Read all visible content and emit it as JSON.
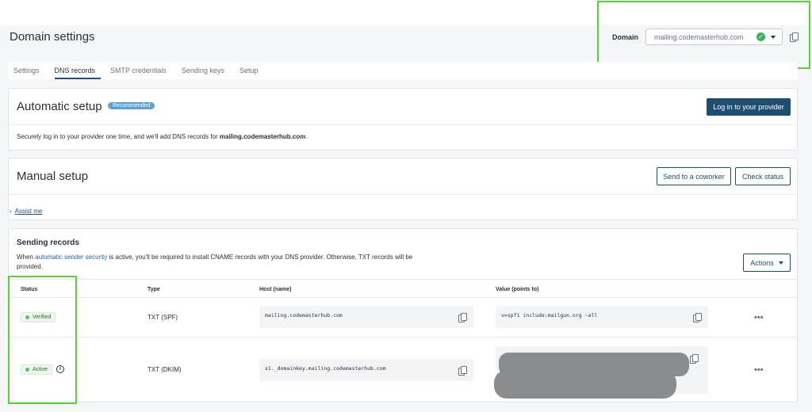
{
  "page": {
    "title": "Domain settings"
  },
  "domain": {
    "label": "Domain",
    "value": "mailing.codemasterhub.com",
    "status_icon": "check-circle-icon",
    "copy_icon": "copy-icon"
  },
  "tabs": [
    {
      "label": "Settings"
    },
    {
      "label": "DNS records",
      "active": true
    },
    {
      "label": "SMTP credentials"
    },
    {
      "label": "Sending keys"
    },
    {
      "label": "Setup"
    }
  ],
  "automatic": {
    "title": "Automatic setup",
    "badge": "Recommended",
    "button": "Log in to your provider",
    "desc_prefix": "Securely log in to your provider one time, and we'll add DNS records for ",
    "desc_domain": "mailing.codemasterhub.com",
    "desc_suffix": "."
  },
  "manual": {
    "title": "Manual setup",
    "send_button": "Send to a coworker",
    "check_button": "Check status",
    "assist_chevron": "›",
    "assist_link": "Assist me"
  },
  "sending": {
    "title": "Sending records",
    "desc_prefix": "When ",
    "desc_link": "automatic sender security",
    "desc_suffix": " is active, you'll be required to install CNAME records with your DNS provider. Otherwise, TXT records will be provided.",
    "actions_button": "Actions",
    "columns": {
      "status": "Status",
      "type": "Type",
      "host": "Host (name)",
      "value": "Value (points to)"
    },
    "rows": [
      {
        "status": "Verified",
        "type": "TXT (SPF)",
        "host": "mailing.codemasterhub.com",
        "value": "v=spf1 include:mailgun.org ~all",
        "more": "•••"
      },
      {
        "status": "Active",
        "type": "TXT (DKIM)",
        "host": "s1._domainkey.mailing.codemasterhub.com",
        "value": "",
        "more": "•••",
        "info": "i"
      }
    ]
  },
  "colors": {
    "accent": "#1e4d72",
    "highlight": "#58d33a",
    "success": "#3ab45a"
  }
}
